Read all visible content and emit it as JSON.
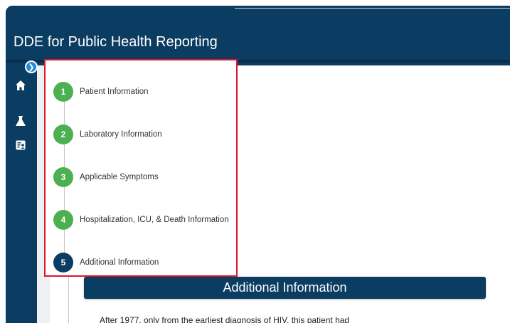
{
  "app": {
    "title": "DDE for Public Health Reporting"
  },
  "sidebar": {
    "items": [
      {
        "icon": "home-icon"
      },
      {
        "icon": "flask-icon"
      },
      {
        "icon": "report-icon"
      }
    ],
    "collapse_icon": "chevron-right-icon"
  },
  "stepper": {
    "steps": [
      {
        "number": "1",
        "label": "Patient Information",
        "status": "complete"
      },
      {
        "number": "2",
        "label": "Laboratory Information",
        "status": "complete"
      },
      {
        "number": "3",
        "label": "Applicable Symptoms",
        "status": "complete"
      },
      {
        "number": "4",
        "label": "Hospitalization, ICU, & Death Information",
        "status": "complete"
      },
      {
        "number": "5",
        "label": "Additional Information",
        "status": "current"
      }
    ]
  },
  "section": {
    "title": "Additional Information",
    "body": "After 1977, only from the earliest diagnosis of HIV, this patient had"
  },
  "colors": {
    "primary": "#0b3c61",
    "complete": "#4caf50",
    "highlight": "#e0142b"
  }
}
